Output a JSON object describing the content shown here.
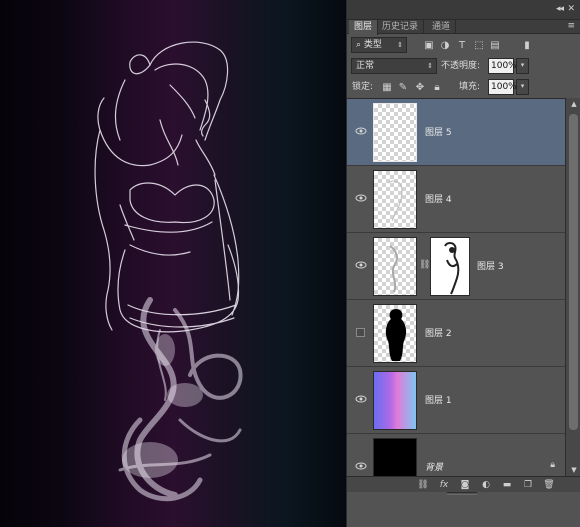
{
  "panel": {
    "collapse_icon": "double-chevron-icon",
    "menu_icon": "panel-menu-icon",
    "tabs": [
      {
        "label": "图层",
        "active": true
      },
      {
        "label": "历史记录",
        "active": false
      },
      {
        "label": "通道",
        "active": false
      }
    ]
  },
  "filter": {
    "search_icon": "search-icon",
    "kind_label": "类型",
    "filter_icons": [
      "image-filter-icon",
      "adjustment-filter-icon",
      "type-filter-icon",
      "shape-filter-icon",
      "smart-object-filter-icon",
      "filter-toggle-icon"
    ]
  },
  "blend": {
    "mode": "正常",
    "opacity_label": "不透明度:",
    "opacity_value": "100%"
  },
  "lock": {
    "label": "锁定:",
    "fill_label": "填充:",
    "fill_value": "100%"
  },
  "layers": [
    {
      "name": "图层 5",
      "visible": true,
      "selected": true,
      "thumb": "transparent"
    },
    {
      "name": "图层 4",
      "visible": true,
      "selected": false,
      "thumb": "transparent-light"
    },
    {
      "name": "图层 3",
      "visible": true,
      "selected": false,
      "thumb": "transparent-light",
      "has_mask": true
    },
    {
      "name": "图层 2",
      "visible": false,
      "selected": false,
      "thumb": "silhouette"
    },
    {
      "name": "图层 1",
      "visible": true,
      "selected": false,
      "thumb": "gradient"
    },
    {
      "name": "背景",
      "visible": true,
      "selected": false,
      "thumb": "black",
      "locked": true
    }
  ],
  "bottom_tools": [
    "link-layers-icon",
    "fx-icon",
    "add-mask-icon",
    "adjustment-layer-icon",
    "new-group-icon",
    "new-layer-icon",
    "trash-icon"
  ],
  "colors": {
    "panel_bg": "#535353",
    "selected_row": "#5a6a80",
    "canvas_purple": "#2b0f2e"
  }
}
